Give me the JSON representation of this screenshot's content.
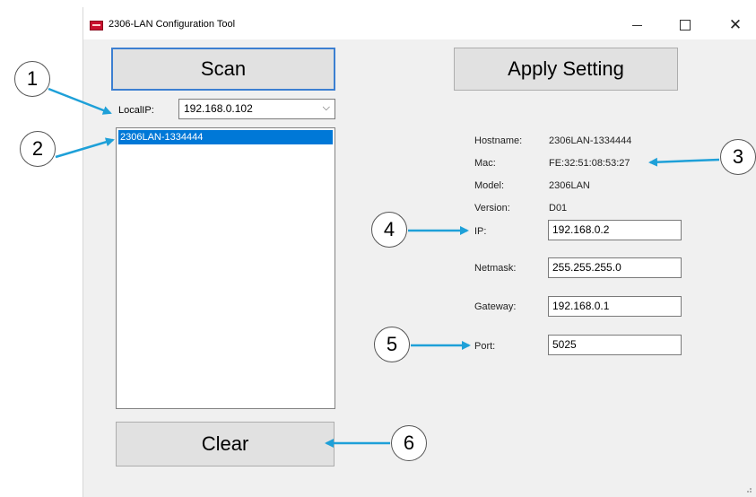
{
  "window": {
    "title": "2306-LAN Configuration Tool",
    "controls": {
      "minimize": "minimize",
      "maximize": "maximize",
      "close": "✕"
    }
  },
  "buttons": {
    "scan": "Scan",
    "apply": "Apply Setting",
    "clear": "Clear"
  },
  "local_ip": {
    "label": "LocalIP:",
    "value": "192.168.0.102"
  },
  "device_list": [
    "2306LAN-1334444"
  ],
  "device_info": {
    "hostname": {
      "label": "Hostname:",
      "value": "2306LAN-1334444"
    },
    "mac": {
      "label": "Mac:",
      "value": "FE:32:51:08:53:27"
    },
    "model": {
      "label": "Model:",
      "value": "2306LAN"
    },
    "version": {
      "label": "Version:",
      "value": "D01"
    }
  },
  "settings": {
    "ip": {
      "label": "IP:",
      "value": "192.168.0.2"
    },
    "netmask": {
      "label": "Netmask:",
      "value": "255.255.255.0"
    },
    "gateway": {
      "label": "Gateway:",
      "value": "192.168.0.1"
    },
    "port": {
      "label": "Port:",
      "value": "5025"
    }
  },
  "callouts": [
    "1",
    "2",
    "3",
    "4",
    "5",
    "6"
  ],
  "colors": {
    "selection": "#0078d7",
    "focus_border": "#3c7fd1",
    "arrow": "#1ea0d8"
  }
}
